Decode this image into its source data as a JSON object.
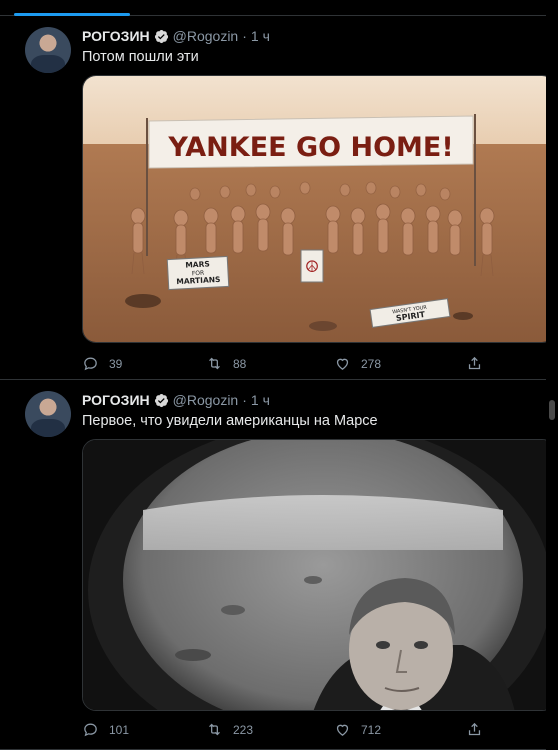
{
  "tweets": [
    {
      "author_name": "РОГОЗИН",
      "handle": "@Rogozin",
      "separator": "·",
      "time": "1 ч",
      "text": "Потом пошли эти",
      "media": {
        "banner_text": "YANKEE GO HOME!",
        "sign_left": "MARS FOR MARTIANS",
        "sign_right": "WASN'T YOUR SPIRIT",
        "sign_left_lines": [
          "MARS",
          "FOR",
          "MARTIANS"
        ],
        "sign_right_lines": [
          "WASN'T YOUR",
          "SPIRIT"
        ],
        "peace_symbol": "☮"
      },
      "replies": "39",
      "retweets": "88",
      "likes": "278"
    },
    {
      "author_name": "РОГОЗИН",
      "handle": "@Rogozin",
      "separator": "·",
      "time": "1 ч",
      "text": "Первое, что увидели американцы на Марсе",
      "replies": "101",
      "retweets": "223",
      "likes": "712"
    }
  ],
  "icons": {
    "reply": "reply-icon",
    "retweet": "retweet-icon",
    "like": "heart-icon",
    "share": "share-icon",
    "verified": "verified-badge-icon"
  },
  "colors": {
    "background": "#000000",
    "accent": "#1d9bf0",
    "secondary_text": "#8b98a5"
  }
}
